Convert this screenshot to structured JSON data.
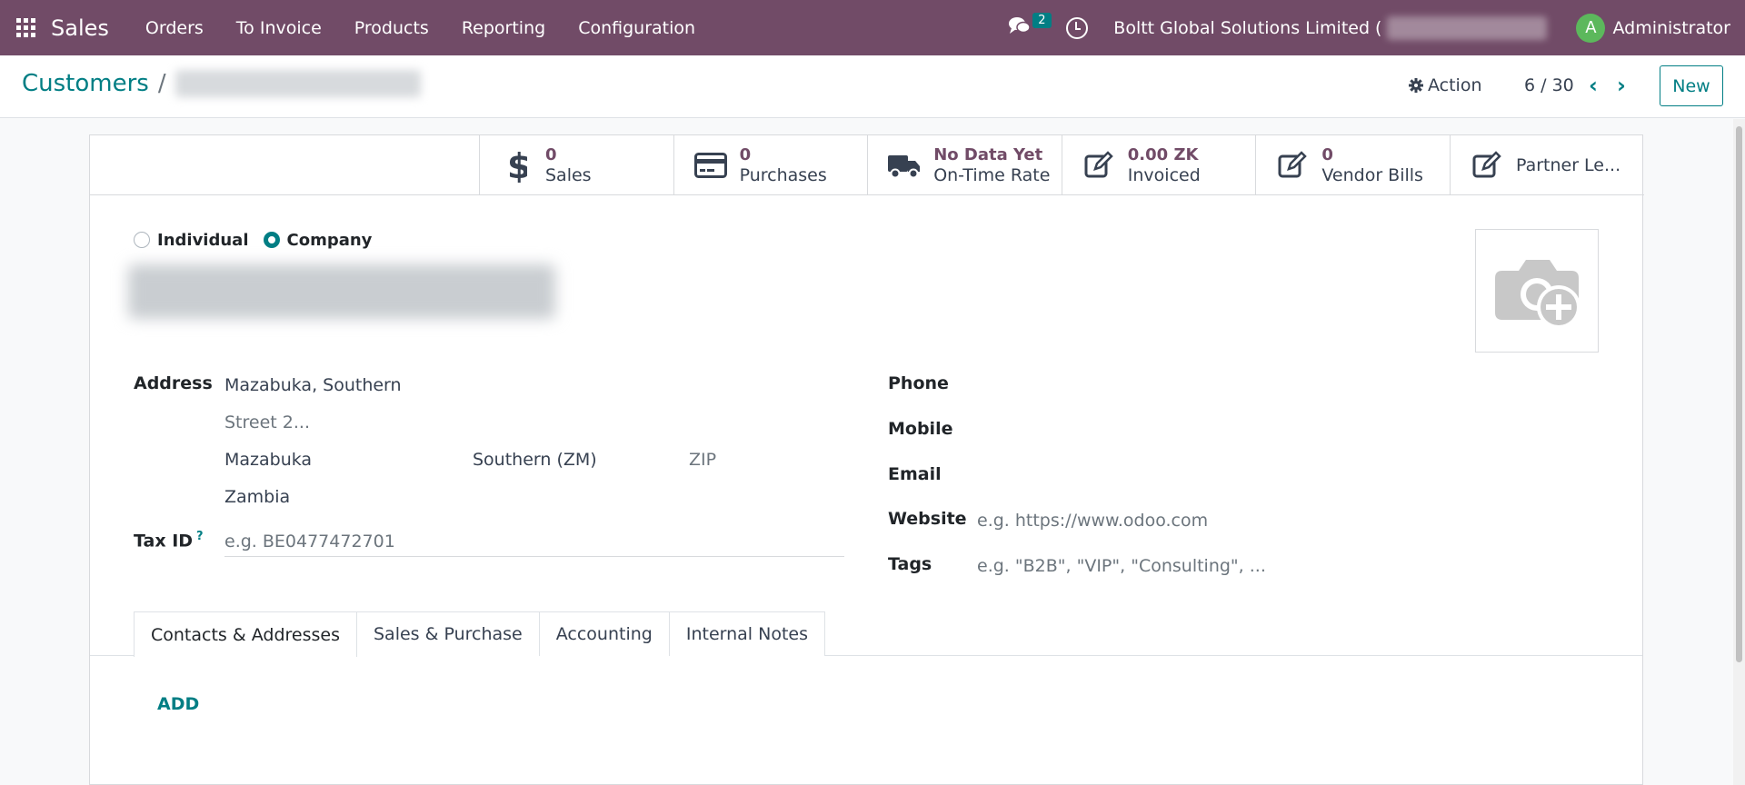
{
  "navbar": {
    "app_name": "Sales",
    "menu": [
      "Orders",
      "To Invoice",
      "Products",
      "Reporting",
      "Configuration"
    ],
    "chat_count": "2",
    "company": "Boltt Global Solutions Limited (",
    "user_initial": "A",
    "user_name": "Administrator",
    "avatar_color": "#5cb85c",
    "brand_color": "#714b67"
  },
  "control": {
    "breadcrumb_root": "Customers",
    "breadcrumb_sep": "/",
    "action_label": "Action",
    "pager": "6 / 30",
    "new_label": "New"
  },
  "stats": [
    {
      "icon": "dollar-icon",
      "value": "0",
      "label": "Sales"
    },
    {
      "icon": "credit-card-icon",
      "value": "0",
      "label": "Purchases"
    },
    {
      "icon": "truck-icon",
      "value": "No Data Yet",
      "label": "On-Time Rate"
    },
    {
      "icon": "edit-icon",
      "value": "0.00 ZK",
      "label": "Invoiced"
    },
    {
      "icon": "edit-icon",
      "value": "0",
      "label": "Vendor Bills"
    },
    {
      "icon": "edit-icon",
      "label": "Partner Le..."
    }
  ],
  "form": {
    "type_individual": "Individual",
    "type_company": "Company",
    "address_label": "Address",
    "street": "Mazabuka, Southern",
    "street2_placeholder": "Street 2...",
    "city": "Mazabuka",
    "state": "Southern (ZM)",
    "zip_placeholder": "ZIP",
    "country": "Zambia",
    "tax_label": "Tax ID",
    "tax_help": "?",
    "tax_placeholder": "e.g. BE0477472701",
    "phone_label": "Phone",
    "mobile_label": "Mobile",
    "email_label": "Email",
    "website_label": "Website",
    "website_placeholder": "e.g. https://www.odoo.com",
    "tags_label": "Tags",
    "tags_placeholder": "e.g. \"B2B\", \"VIP\", \"Consulting\", ..."
  },
  "tabs": [
    "Contacts & Addresses",
    "Sales & Purchase",
    "Accounting",
    "Internal Notes"
  ],
  "add_label": "ADD",
  "accent_color": "#017e84"
}
